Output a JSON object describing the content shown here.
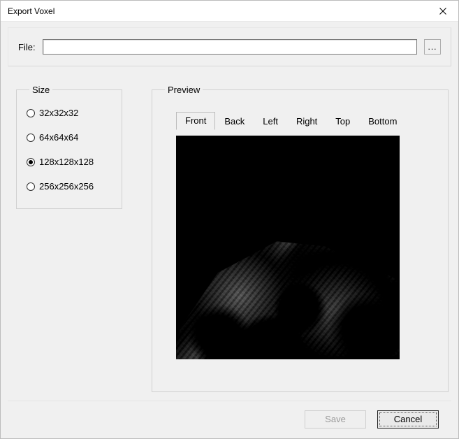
{
  "window": {
    "title": "Export Voxel"
  },
  "file": {
    "label": "File:",
    "value": "",
    "placeholder": "",
    "browse_label": "..."
  },
  "size": {
    "legend": "Size",
    "options": [
      {
        "label": "32x32x32",
        "selected": false
      },
      {
        "label": "64x64x64",
        "selected": false
      },
      {
        "label": "128x128x128",
        "selected": true
      },
      {
        "label": "256x256x256",
        "selected": false
      }
    ]
  },
  "preview": {
    "legend": "Preview",
    "tabs": [
      {
        "label": "Front",
        "active": true
      },
      {
        "label": "Back",
        "active": false
      },
      {
        "label": "Left",
        "active": false
      },
      {
        "label": "Right",
        "active": false
      },
      {
        "label": "Top",
        "active": false
      },
      {
        "label": "Bottom",
        "active": false
      }
    ]
  },
  "buttons": {
    "save": "Save",
    "save_enabled": false,
    "cancel": "Cancel"
  }
}
